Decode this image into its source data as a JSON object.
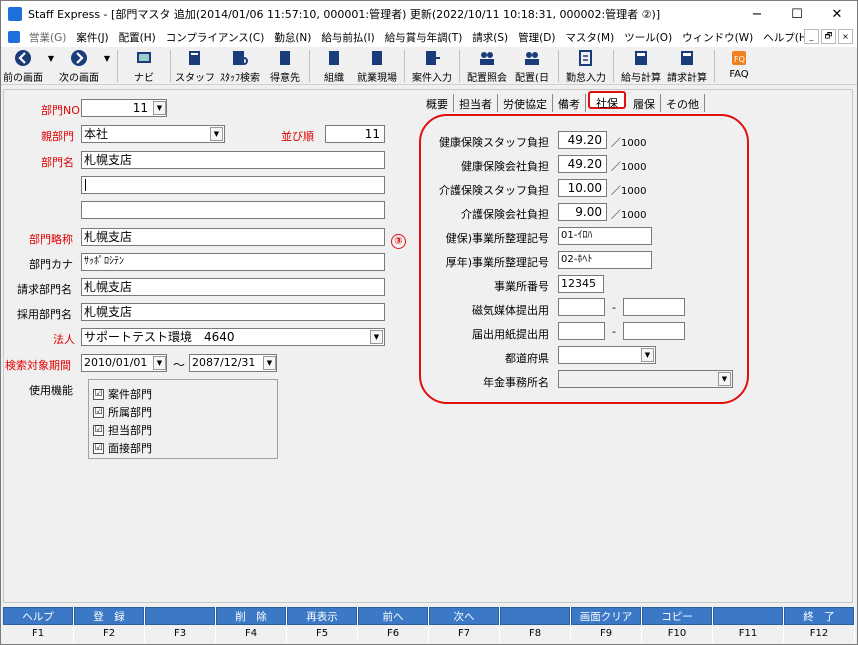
{
  "window": {
    "title": "Staff Express - [部門マスタ  追加(2014/01/06 11:57:10, 000001:管理者) 更新(2022/10/11 10:18:31, 000002:管理者  ②)]",
    "minimize": "−",
    "maximize": "☐",
    "close": "✕"
  },
  "menu": {
    "items": [
      "営業(G)",
      "案件(J)",
      "配置(H)",
      "コンプライアンス(C)",
      "勤怠(N)",
      "給与前払(I)",
      "給与賞与年調(T)",
      "請求(S)",
      "管理(D)",
      "マスタ(M)",
      "ツール(O)",
      "ウィンドウ(W)",
      "ヘルプ(H)"
    ],
    "mdi": [
      "_",
      "🗗",
      "×"
    ]
  },
  "toolbar": {
    "buttons": [
      "前の画面",
      "次の画面",
      "ナビ",
      "スタッフ",
      "ｽﾀｯﾌ検索",
      "得意先",
      "組織",
      "就業現場",
      "案件入力",
      "配置照会",
      "配置(日",
      "勤怠入力",
      "給与計算",
      "請求計算",
      "FAQ"
    ]
  },
  "form": {
    "dept_no_label": "部門NO",
    "dept_no": "11",
    "parent_label": "親部門",
    "parent": "本社",
    "order_label": "並び順",
    "order": "11",
    "name_label": "部門名",
    "name1": "札幌支店",
    "name2": "",
    "name3": "",
    "short_label": "部門略称",
    "short": "札幌支店",
    "kana_label": "部門カナ",
    "kana": "ｻｯﾎﾟﾛｼﾃﾝ",
    "billing_label": "請求部門名",
    "billing": "札幌支店",
    "hiring_label": "採用部門名",
    "hiring": "札幌支店",
    "corp_label": "法人",
    "corp": "サポートテスト環境　4640",
    "period_label": "検索対象期間",
    "period_from": "2010/01/01",
    "tilde": "～",
    "period_to": "2087/12/31",
    "func_label": "使用機能",
    "functions": [
      {
        "label": "案件部門",
        "checked": true
      },
      {
        "label": "所属部門",
        "checked": true
      },
      {
        "label": "担当部門",
        "checked": true
      },
      {
        "label": "面接部門",
        "checked": true
      }
    ],
    "check": "☑"
  },
  "tabs": [
    "概要",
    "担当者",
    "労使協定",
    "備考",
    "社保",
    "履保",
    "その他"
  ],
  "social": {
    "annotation": "③",
    "unit": "／1000",
    "dash": "-",
    "rows": [
      {
        "label": "健康保険スタッフ負担",
        "value": "49.20"
      },
      {
        "label": "健康保険会社負担",
        "value": "49.20"
      },
      {
        "label": "介護保険スタッフ負担",
        "value": "10.00"
      },
      {
        "label": "介護保険会社負担",
        "value": "9.00"
      }
    ],
    "kenpo_label": "健保)事業所整理記号",
    "kenpo": "01-ｲﾛﾊ",
    "kounen_label": "厚年)事業所整理記号",
    "kounen": "02-ﾎﾍﾄ",
    "office_no_label": "事業所番号",
    "office_no": "12345",
    "magnetic_label": "磁気媒体提出用",
    "magnetic1": "",
    "magnetic2": "",
    "paper_label": "届出用紙提出用",
    "paper1": "",
    "paper2": "",
    "pref_label": "都道府県",
    "pref": "",
    "pension_label": "年金事務所名",
    "pension": ""
  },
  "fkeys": [
    {
      "label": "ヘルプ",
      "key": "F1"
    },
    {
      "label": "登　録",
      "key": "F2"
    },
    {
      "label": "",
      "key": "F3"
    },
    {
      "label": "削　除",
      "key": "F4"
    },
    {
      "label": "再表示",
      "key": "F5"
    },
    {
      "label": "前へ",
      "key": "F6"
    },
    {
      "label": "次へ",
      "key": "F7"
    },
    {
      "label": "",
      "key": "F8"
    },
    {
      "label": "画面クリア",
      "key": "F9"
    },
    {
      "label": "コピー",
      "key": "F10"
    },
    {
      "label": "",
      "key": "F11"
    },
    {
      "label": "終　了",
      "key": "F12"
    }
  ],
  "colors": {
    "accent": "#3b78c6",
    "highlight": "#e01010",
    "label_red": "#e00000"
  }
}
